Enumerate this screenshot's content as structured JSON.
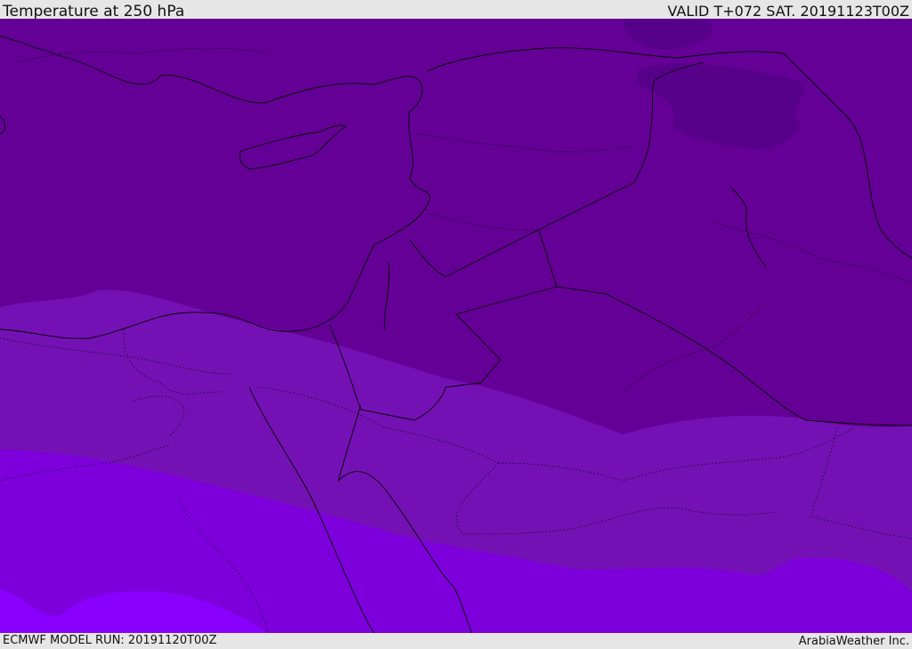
{
  "header": {
    "title": "Temperature at 250 hPa",
    "valid": "VALID T+072 SAT. 20191123T00Z"
  },
  "footer": {
    "model_run": "ECMWF MODEL RUN: 20191120T00Z",
    "credit": "ArabiaWeather Inc."
  },
  "colors": {
    "band_coldest": "#4f0080",
    "band_1": "#640096",
    "band_2": "#7411b4",
    "band_3": "#7d00dc",
    "band_4": "#8a00ff",
    "border": "#000000"
  }
}
